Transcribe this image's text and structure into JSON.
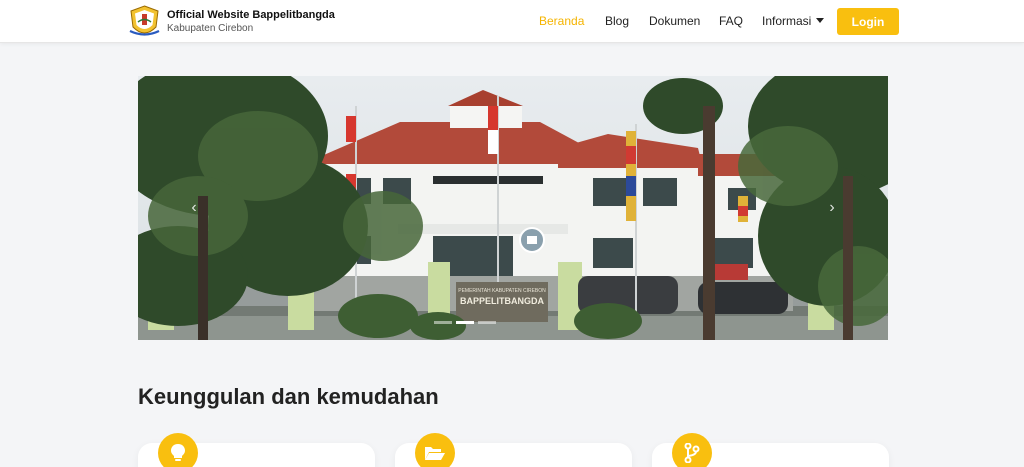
{
  "brand": {
    "title": "Official Website Bappelitbangda",
    "subtitle": "Kabupaten Cirebon",
    "logo_icon": "cirebon-regency-crest-icon"
  },
  "nav": {
    "items": [
      {
        "label": "Beranda",
        "active": true
      },
      {
        "label": "Blog",
        "active": false
      },
      {
        "label": "Dokumen",
        "active": false
      },
      {
        "label": "FAQ",
        "active": false
      },
      {
        "label": "Informasi",
        "active": false,
        "dropdown": true
      }
    ],
    "login_label": "Login"
  },
  "hero": {
    "image_description_icon": "office-building-photo",
    "sign_text_top": "PEMERINTAH KABUPATEN CIREBON",
    "sign_text_main": "BAPPELITBANGDA",
    "slide_count": 3,
    "active_slide": 1
  },
  "section": {
    "title": "Keunggulan dan kemudahan"
  },
  "features": [
    {
      "icon": "lightbulb-icon"
    },
    {
      "icon": "folder-open-icon"
    },
    {
      "icon": "code-branch-icon"
    }
  ],
  "colors": {
    "accent": "#f9bf0f",
    "active_nav": "#f5b400",
    "background": "#f4f5f7"
  }
}
